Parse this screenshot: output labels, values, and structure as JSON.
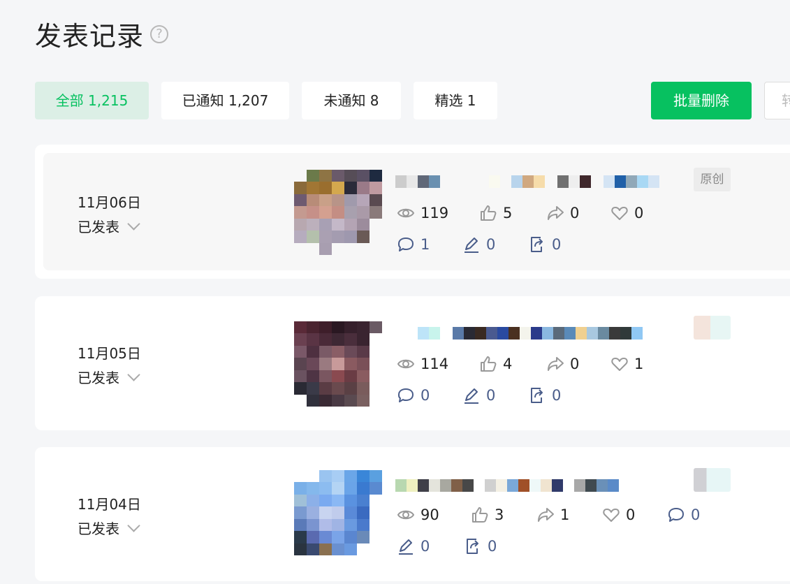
{
  "page": {
    "title": "发表记录",
    "help_glyph": "?"
  },
  "tabs": [
    {
      "label": "全部 1,215",
      "active": true
    },
    {
      "label": "已通知 1,207",
      "active": false
    },
    {
      "label": "未通知 8",
      "active": false
    },
    {
      "label": "精选 1",
      "active": false
    }
  ],
  "actions": {
    "batch_delete": "批量删除",
    "edge_button": "转"
  },
  "accent_color": "#07c160",
  "posts": [
    {
      "date": "11月06日",
      "status": "已发表",
      "badge": "原创",
      "views": "119",
      "likes": "5",
      "shares": "0",
      "favorites": "0",
      "comments": "1",
      "edits": "0",
      "forwards": "0"
    },
    {
      "date": "11月05日",
      "status": "已发表",
      "badge": "",
      "views": "114",
      "likes": "4",
      "shares": "0",
      "favorites": "1",
      "comments": "0",
      "edits": "0",
      "forwards": "0"
    },
    {
      "date": "11月04日",
      "status": "已发表",
      "badge": "",
      "views": "90",
      "likes": "3",
      "shares": "1",
      "favorites": "0",
      "comments": "0",
      "edits": "0",
      "forwards": "0"
    }
  ]
}
